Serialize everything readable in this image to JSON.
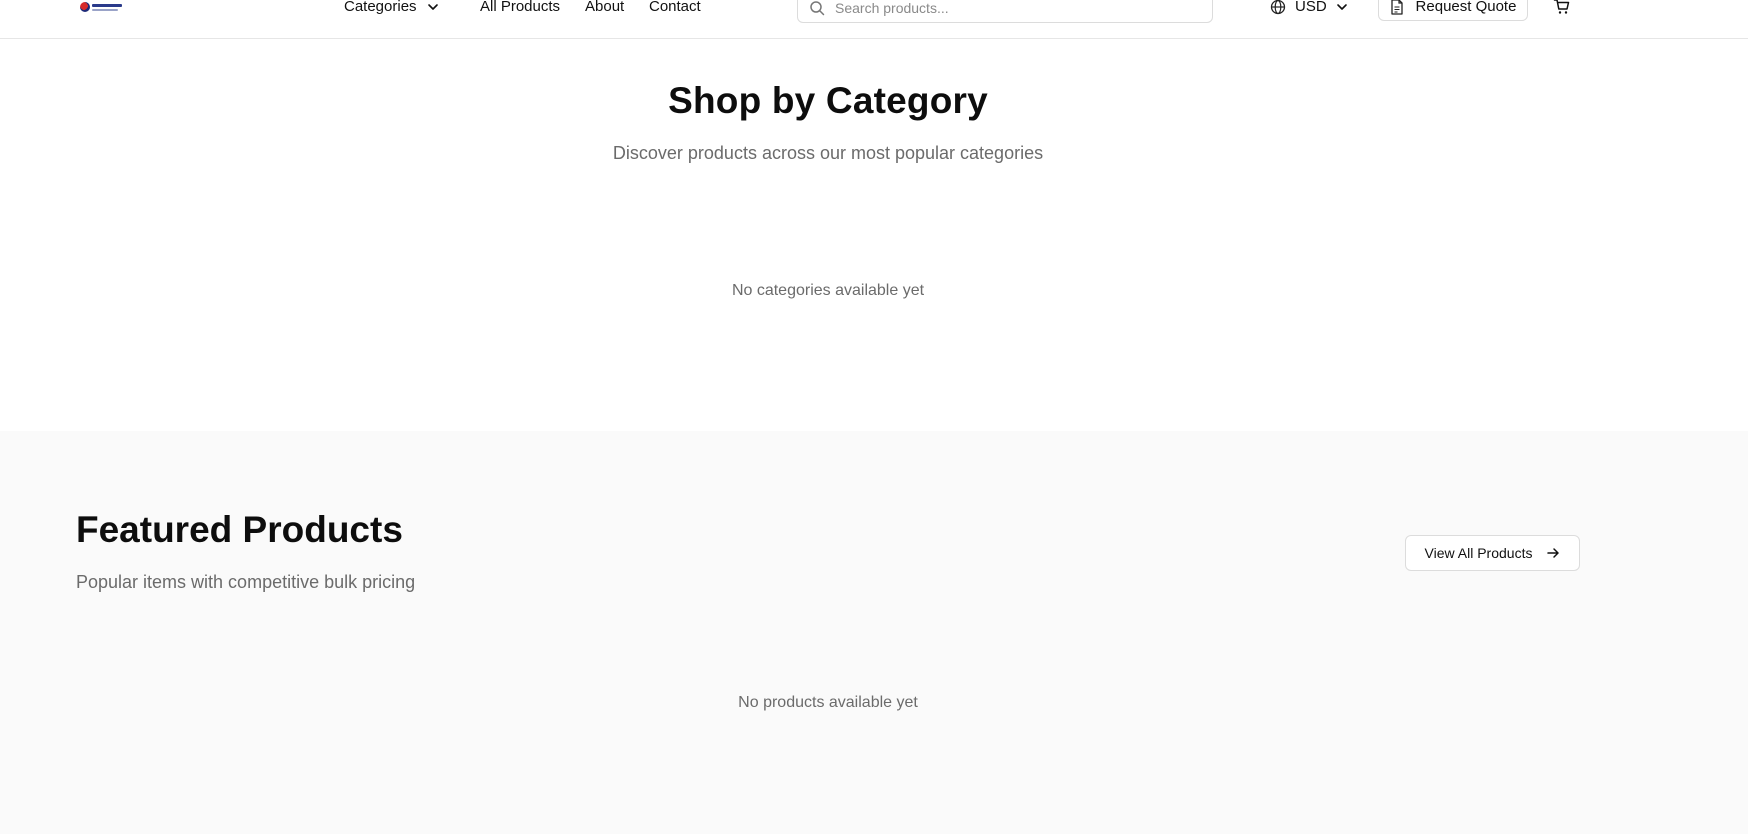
{
  "header": {
    "logo_alt": "Store logo",
    "nav": {
      "categories": "Categories",
      "all_products": "All Products",
      "about": "About",
      "contact": "Contact"
    },
    "search": {
      "placeholder": "Search products...",
      "value": ""
    },
    "currency": "USD",
    "request_quote": "Request Quote",
    "icons": {
      "chevron": "chevron-down-icon",
      "search": "search-icon",
      "globe": "globe-icon",
      "document": "document-icon",
      "cart": "cart-icon"
    }
  },
  "categories_section": {
    "title": "Shop by Category",
    "subtitle": "Discover products across our most popular categories",
    "empty_message": "No categories available yet"
  },
  "featured_section": {
    "title": "Featured Products",
    "subtitle": "Popular items with competitive bulk pricing",
    "view_all": "View All Products",
    "empty_message": "No products available yet",
    "icons": {
      "arrow": "arrow-right-icon"
    }
  },
  "colors": {
    "text": "#111111",
    "muted": "#6b6b6b",
    "border": "#dcdcdc",
    "section_bg": "#fafafa"
  }
}
